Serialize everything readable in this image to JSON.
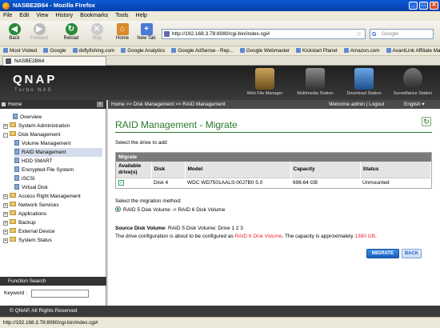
{
  "window": {
    "title": "NASBE2B64 - Mozilla Firefox",
    "min": "_",
    "max": "□",
    "close": "✕"
  },
  "menu": [
    "File",
    "Edit",
    "View",
    "History",
    "Bookmarks",
    "Tools",
    "Help"
  ],
  "nav": {
    "back": "Back",
    "forward": "Forward",
    "reload": "Reload",
    "stop": "Stop",
    "home": "Home",
    "newtab": "New Tab"
  },
  "address": {
    "url": "http://192.168.3.78:8080/cgi-bin/index.cgi#"
  },
  "search": {
    "placeholder": "Google",
    "engine": "G"
  },
  "bookmarks": [
    "Most Visited",
    "Google",
    "dsflyfishing.com",
    "Google Analytics",
    "Google AdSense - Rep...",
    "Google Webmaster",
    "Kickstart Planet",
    "Amazon.com",
    "AvantLink Affiliate Ma..."
  ],
  "tab": {
    "label": "NASBE2B64"
  },
  "brand": {
    "logo": "QNAP",
    "sub": "Turbo NAS"
  },
  "stations": [
    "Web File Manager",
    "Multimedia Station",
    "Download Station",
    "Surveillance Station"
  ],
  "breadcrumb": "Home >> Disk Management >> RAID Management",
  "welcome": "Welcome admin | Logout",
  "language": "English",
  "sidebar": {
    "header": "Home",
    "collapse": "«",
    "items": [
      "Overview",
      "System Administration",
      "Disk Management",
      "Volume Management",
      "RAID Management",
      "HDD SMART",
      "Encrypted File System",
      "iSCSI",
      "Virtual Disk",
      "Access Right Management",
      "Network Services",
      "Applications",
      "Backup",
      "External Device",
      "System Status"
    ]
  },
  "function_search": {
    "header": "Function Search",
    "keyword_label": "Keyword :"
  },
  "page": {
    "title": "RAID Management - Migrate",
    "instruction": "Select the drive to add",
    "table_caption": "Migrate",
    "columns": [
      "Available drive(s)",
      "Disk",
      "Model",
      "Capacity",
      "Status"
    ],
    "rows": [
      {
        "disk": "Disk 4",
        "model": "WDC WD7501AALS-00J7B0 5.0",
        "capacity": "698.64 GB",
        "status": "Unmounted"
      }
    ],
    "method_label": "Select the migration method:",
    "method_option": "RAID 5 Disk Volume -> RAID 6 Disk Volume",
    "source_label": "Source Disk Volume",
    "source_value": ": RAID 5 Disk Volume: Drive 1 2 3",
    "config_prefix": "The drive configuration is about to be configured as ",
    "config_volume": "RAID 6 Disk Volume",
    "config_mid": ", The capacity is approximately ",
    "config_capacity": "1380 GB",
    "config_suffix": ".",
    "migrate_btn": "MIGRATE",
    "back_btn": "BACK"
  },
  "footer": "© QNAP, All Rights Reserved",
  "statusbar": "http://192.168.3.78:8080/cgi-bin/index.cgi#",
  "colors": {
    "accent_green": "#2b7a2b",
    "highlight_red": "#ee2233",
    "migrate_blue": "#1b5fbf"
  }
}
